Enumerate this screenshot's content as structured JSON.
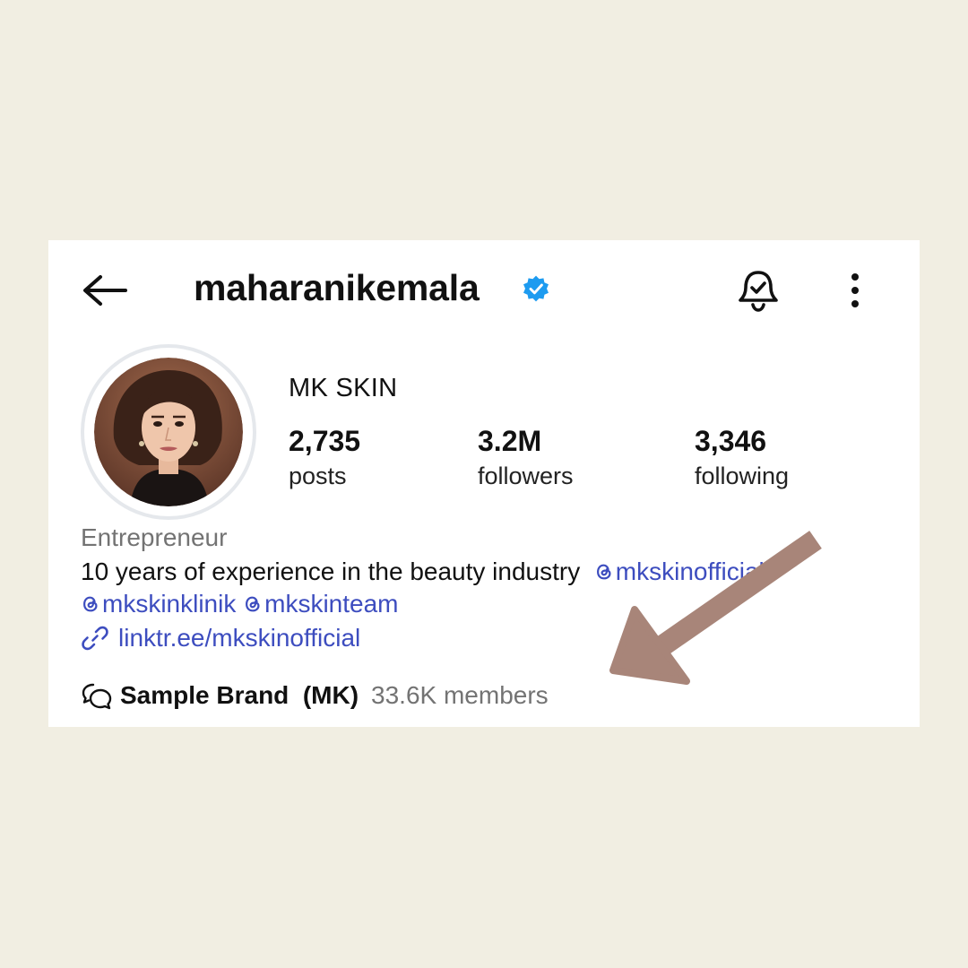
{
  "header": {
    "username": "maharanikemala",
    "back_icon": "arrow-left-icon",
    "verified_icon": "verified-badge-icon",
    "notification_icon": "bell-check-icon",
    "more_icon": "more-vertical-icon"
  },
  "profile": {
    "display_name": "MK SKIN",
    "avatar_icon": "profile-photo"
  },
  "stats": [
    {
      "value": "2,735",
      "label": "posts"
    },
    {
      "value": "3.2M",
      "label": "followers"
    },
    {
      "value": "3,346",
      "label": "following"
    }
  ],
  "bio": {
    "category": "Entrepreneur",
    "text": "10 years of experience in the beauty industry",
    "threads_mentions": [
      "mkskinofficial",
      "mkskinklinik",
      "mkskinteam"
    ],
    "link": "linktr.ee/mkskinofficial"
  },
  "community": {
    "name": "Sample Brand  (MK)",
    "members": "33.6K members",
    "icon": "chat-bubbles-icon"
  },
  "colors": {
    "background": "#f1eee2",
    "card": "#ffffff",
    "link": "#3d4dbf",
    "verified": "#1d9bf0",
    "muted_text": "#737373",
    "arrow": "#a88579"
  }
}
